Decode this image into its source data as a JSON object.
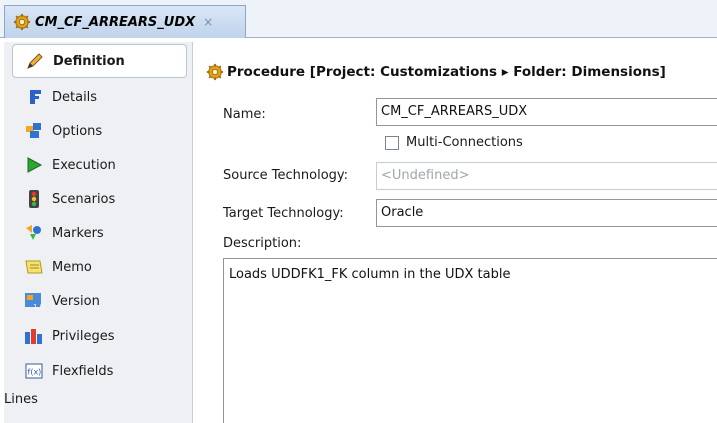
{
  "tab": {
    "title": "CM_CF_ARREARS_UDX",
    "close_glyph": "×",
    "icon": "gear-icon"
  },
  "sidebar": {
    "items": [
      {
        "label": "Definition",
        "icon": "pencil-icon",
        "active": true
      },
      {
        "label": "Details",
        "icon": "details-icon"
      },
      {
        "label": "Options",
        "icon": "options-icon"
      },
      {
        "label": "Execution",
        "icon": "play-icon"
      },
      {
        "label": "Scenarios",
        "icon": "scenarios-icon"
      },
      {
        "label": "Markers",
        "icon": "markers-icon"
      },
      {
        "label": "Memo",
        "icon": "memo-icon"
      },
      {
        "label": "Version",
        "icon": "version-icon"
      },
      {
        "label": "Privileges",
        "icon": "privileges-icon"
      },
      {
        "label": "Flexfields",
        "icon": "flexfields-icon"
      }
    ],
    "footer_label": "Lines"
  },
  "main": {
    "header": "Procedure [Project: Customizations ▸ Folder: Dimensions]",
    "name_label": "Name:",
    "name_value": "CM_CF_ARREARS_UDX",
    "multi_connections_label": "Multi-Connections",
    "multi_connections_checked": false,
    "source_tech_label": "Source Technology:",
    "source_tech_value": "<Undefined>",
    "target_tech_label": "Target Technology:",
    "target_tech_value": "Oracle",
    "description_label": "Description:",
    "description_value": "Loads UDDFK1_FK column in the UDX table"
  },
  "colors": {
    "accent": "#bfd3ec",
    "sidebar_bg": "#eef0f4"
  }
}
